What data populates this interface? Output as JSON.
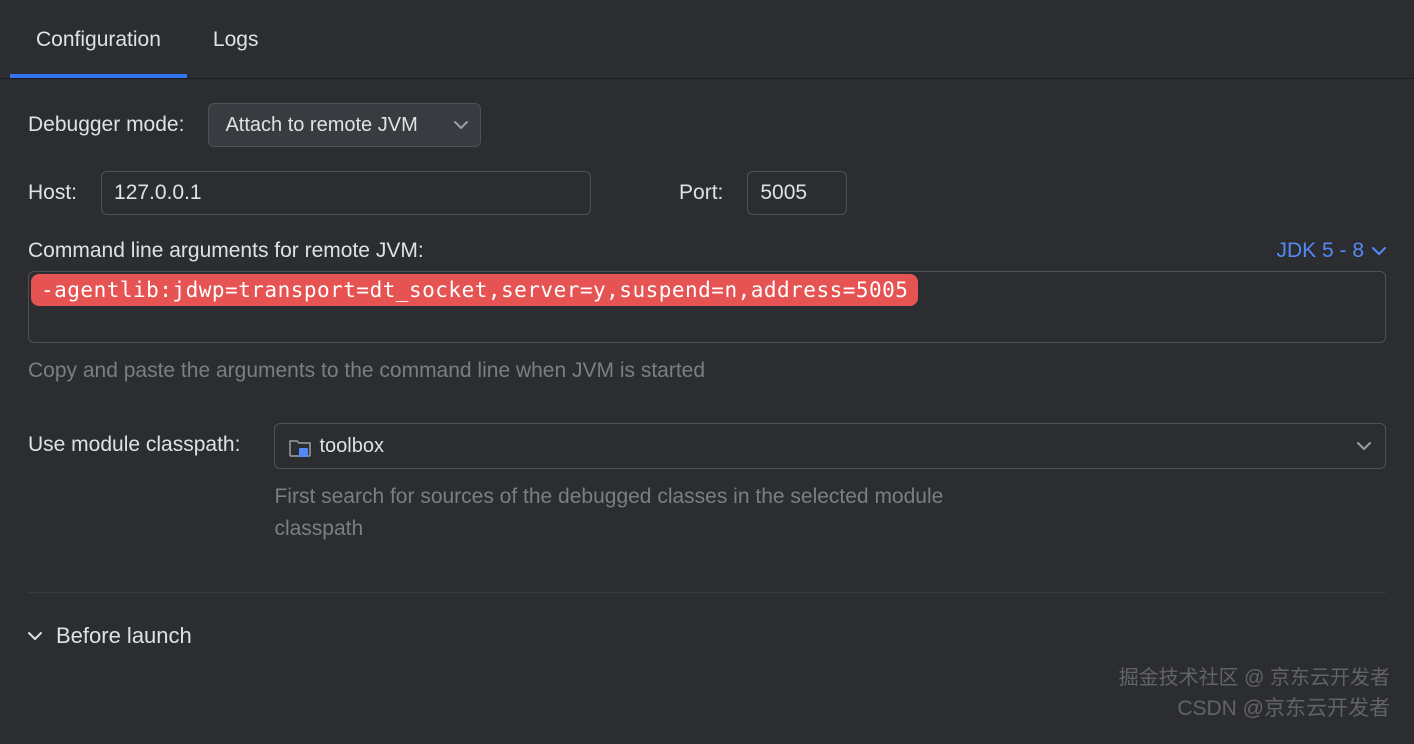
{
  "tabs": {
    "configuration": "Configuration",
    "logs": "Logs"
  },
  "debugger": {
    "label": "Debugger mode:",
    "mode": "Attach to remote JVM"
  },
  "host": {
    "label": "Host:",
    "value": "127.0.0.1"
  },
  "port": {
    "label": "Port:",
    "value": "5005"
  },
  "cli": {
    "label": "Command line arguments for remote JVM:",
    "jdk": "JDK 5 - 8",
    "args": "-agentlib:jdwp=transport=dt_socket,server=y,suspend=n,address=5005",
    "hint": "Copy and paste the arguments to the command line when JVM is started"
  },
  "module": {
    "label": "Use module classpath:",
    "value": "toolbox",
    "hint": "First search for sources of the debugged classes in the selected module classpath"
  },
  "section": {
    "before_launch": "Before launch"
  },
  "watermark": {
    "line1": "掘金技术社区 @ 京东云开发者",
    "line2": "CSDN @京东云开发者"
  }
}
